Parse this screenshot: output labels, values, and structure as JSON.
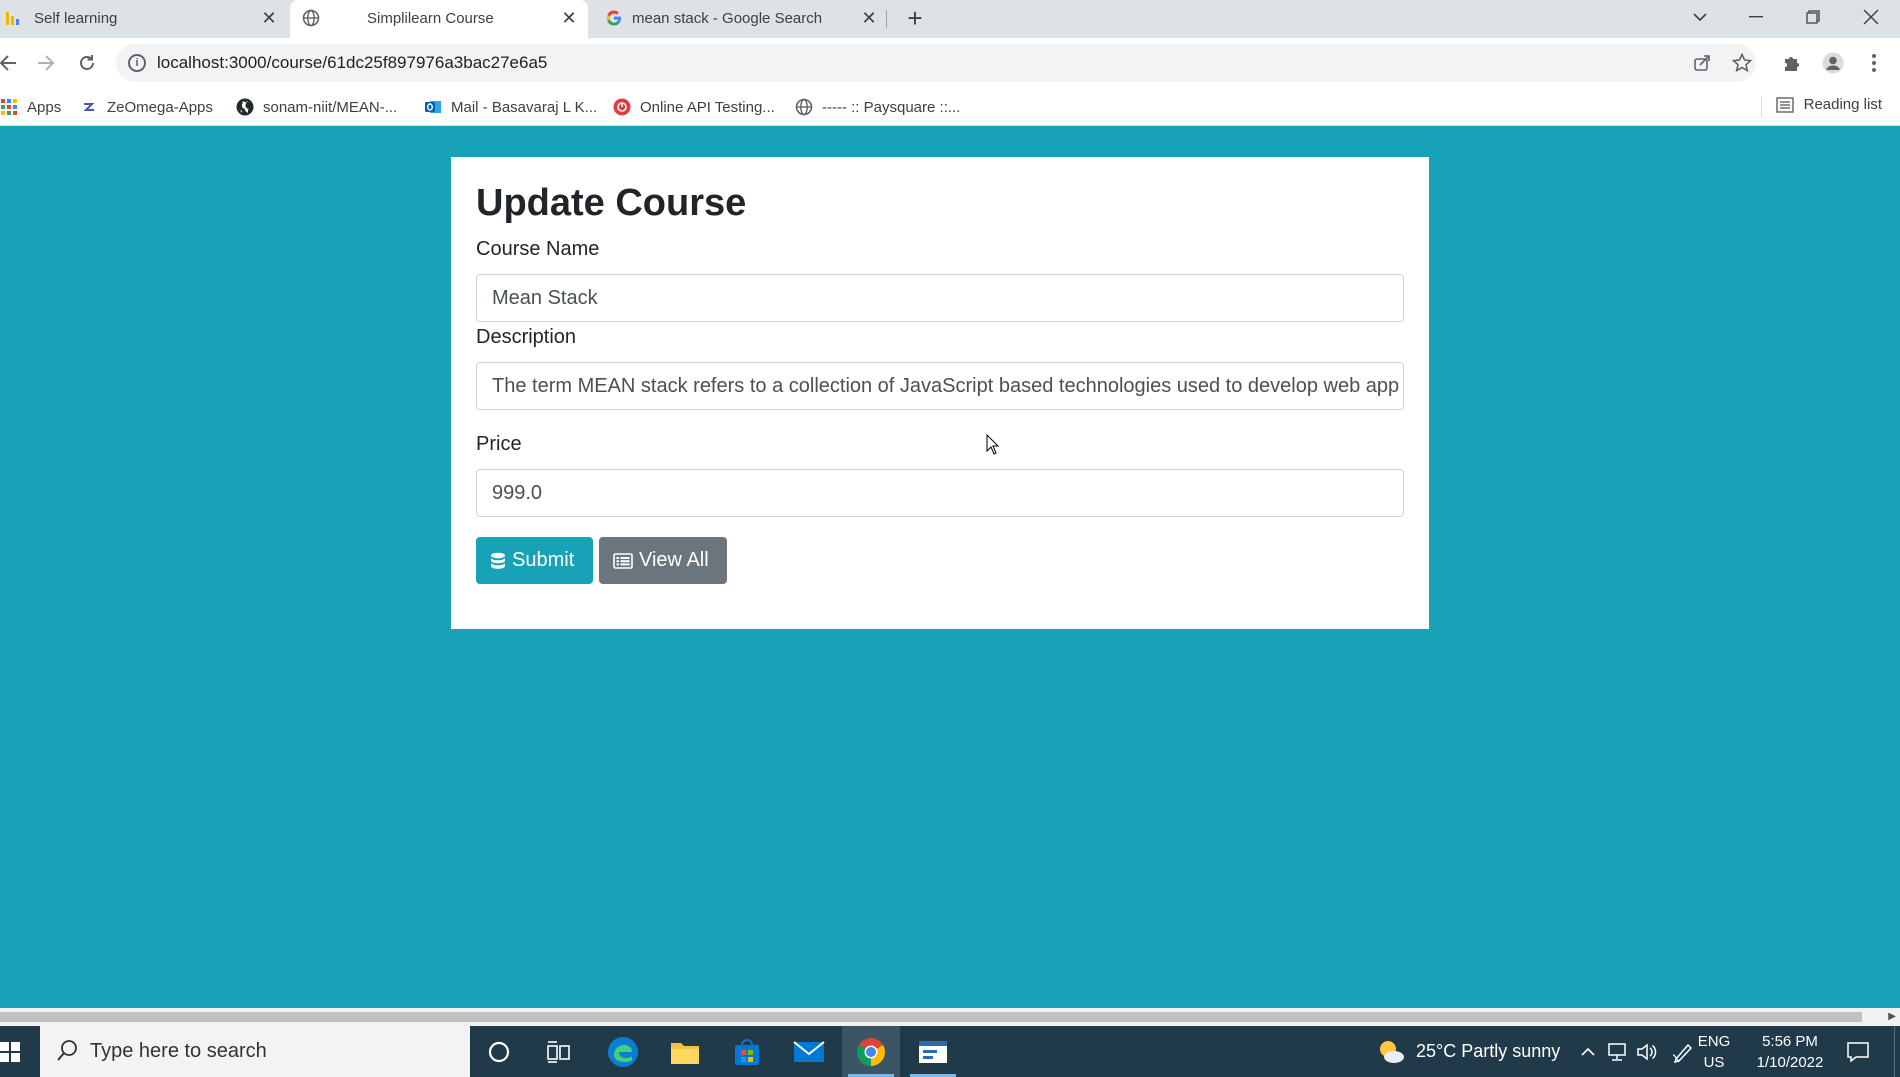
{
  "browser": {
    "tabs": [
      {
        "title": "Self learning",
        "icon": "bar-chart-icon",
        "active": false
      },
      {
        "title": "Simplilearn Course",
        "icon": "globe-icon",
        "active": true
      },
      {
        "title": "mean stack - Google Search",
        "icon": "google-icon",
        "active": false
      }
    ],
    "url": "localhost:3000/course/61dc25f897976a3bac27e6a5",
    "bookmarks": [
      {
        "label": "Apps",
        "icon": "apps-grid-icon"
      },
      {
        "label": "ZeOmega-Apps",
        "icon": "zeomega-icon"
      },
      {
        "label": "sonam-niit/MEAN-...",
        "icon": "github-icon"
      },
      {
        "label": "Mail - Basavaraj L K...",
        "icon": "outlook-icon"
      },
      {
        "label": "Online API Testing...",
        "icon": "api-tester-icon"
      },
      {
        "label": "----- :: Paysquare ::...",
        "icon": "globe-icon"
      }
    ],
    "reading_list": "Reading list"
  },
  "form": {
    "heading": "Update Course",
    "course_name_label": "Course Name",
    "course_name_value": "Mean Stack",
    "description_label": "Description",
    "description_value": "The term MEAN stack refers to a collection of JavaScript based technologies used to develop web app",
    "price_label": "Price",
    "price_value": "999.0",
    "submit_label": "Submit",
    "view_all_label": "View All"
  },
  "taskbar": {
    "search_placeholder": "Type here to search",
    "weather": "25°C  Partly sunny",
    "lang_line1": "ENG",
    "lang_line2": "US",
    "time": "5:56 PM",
    "date": "1/10/2022"
  },
  "colors": {
    "page_background": "#17a2b8",
    "submit_button": "#17a2b8",
    "view_all_button": "#6c757d"
  }
}
